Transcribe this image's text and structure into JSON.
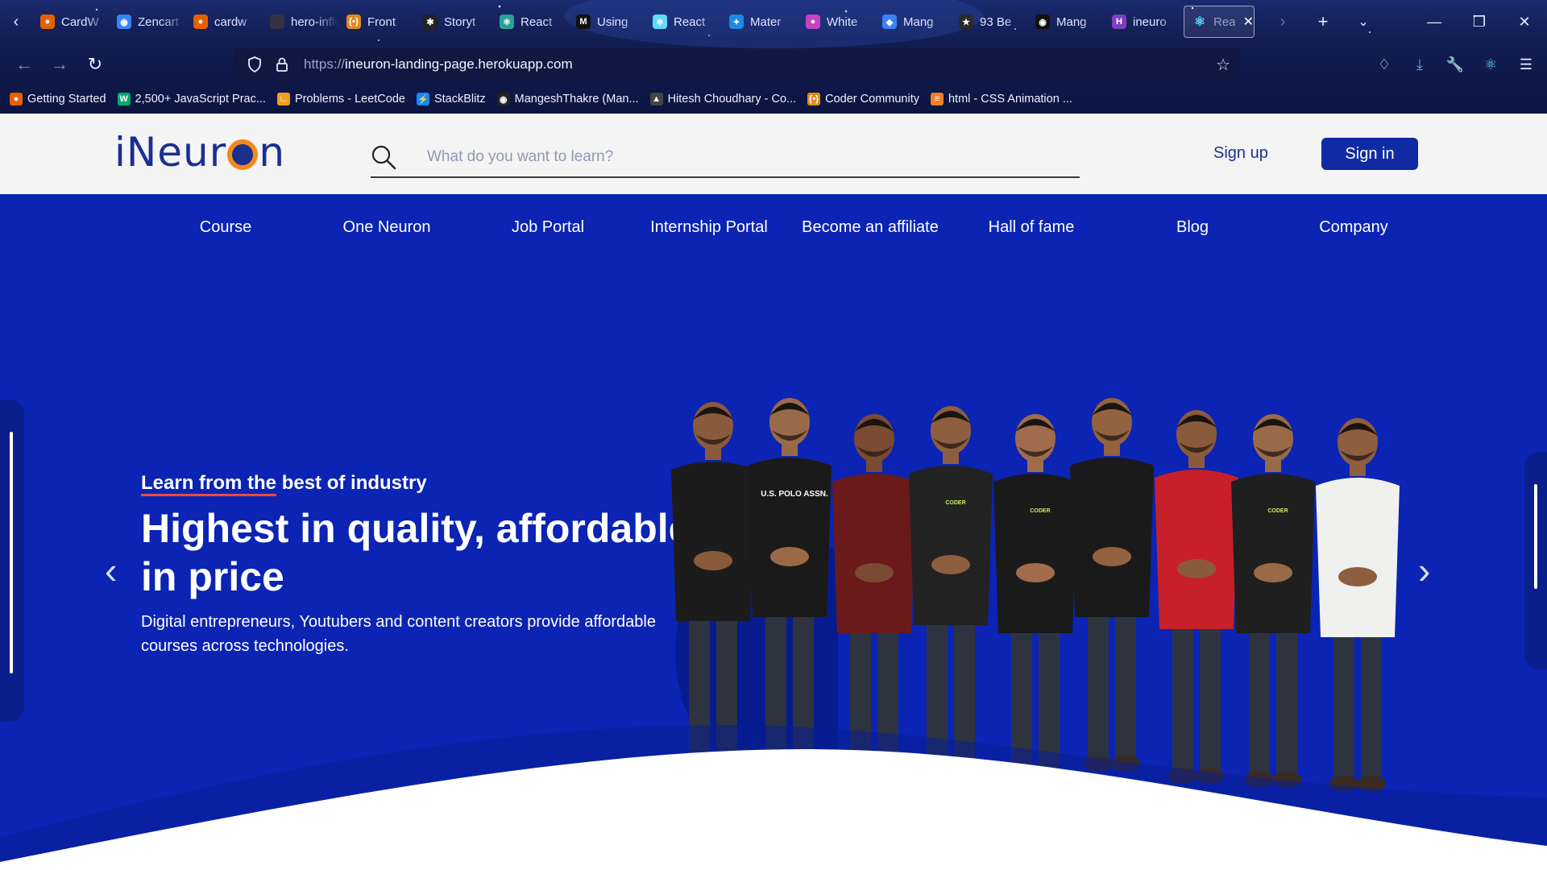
{
  "browser": {
    "tabs": [
      {
        "label": "CardW",
        "icon": "firefox-icon",
        "color": "#e66000"
      },
      {
        "label": "Zencart",
        "icon": "globe-icon",
        "color": "#3b82f6"
      },
      {
        "label": "cardw",
        "icon": "firefox-icon",
        "color": "#e66000"
      },
      {
        "label": "hero-influ",
        "icon": "blank-icon",
        "color": "#334"
      },
      {
        "label": "Front",
        "icon": "code-icon",
        "color": "#e08a1a"
      },
      {
        "label": "Storyt",
        "icon": "sparkle-icon",
        "color": "#222"
      },
      {
        "label": "React",
        "icon": "react-icon",
        "color": "#2aa198"
      },
      {
        "label": "Using",
        "icon": "medium-icon",
        "color": "#111"
      },
      {
        "label": "React",
        "icon": "react-icon",
        "color": "#61dafb"
      },
      {
        "label": "Mater",
        "icon": "material-icon",
        "color": "#1e88e5"
      },
      {
        "label": "White",
        "icon": "drop-icon",
        "color": "#c542c5"
      },
      {
        "label": "Mang",
        "icon": "diamond-icon",
        "color": "#3b82f6"
      },
      {
        "label": "93 Be",
        "icon": "badge-icon",
        "color": "#2a2a2a"
      },
      {
        "label": "Mang",
        "icon": "github-icon",
        "color": "#111"
      },
      {
        "label": "ineuro",
        "icon": "h-icon",
        "color": "#7b3fbf"
      }
    ],
    "active_tab": {
      "label": "Rea",
      "icon": "react-icon"
    },
    "url_proto": "https://",
    "url_host": "ineuron-landing-page.herokuapp.com",
    "bookmarks": [
      {
        "label": "Getting Started",
        "icon": "firefox-icon",
        "color": "#e66000"
      },
      {
        "label": "2,500+ JavaScript Prac...",
        "icon": "w3-icon",
        "color": "#04aa6d"
      },
      {
        "label": "Problems - LeetCode",
        "icon": "leetcode-icon",
        "color": "#f0a020"
      },
      {
        "label": "StackBlitz",
        "icon": "bolt-icon",
        "color": "#1389fd"
      },
      {
        "label": "MangeshThakre (Man...",
        "icon": "github-icon",
        "color": "#222"
      },
      {
        "label": "Hitesh Choudhary - Co...",
        "icon": "cube-icon",
        "color": "#444"
      },
      {
        "label": "Coder Community",
        "icon": "code-icon",
        "color": "#e08a1a"
      },
      {
        "label": "html - CSS Animation ...",
        "icon": "stack-icon",
        "color": "#f48024"
      }
    ]
  },
  "header": {
    "logo_left": "iNeur",
    "logo_right": "n",
    "search_placeholder": "What do you want to learn?",
    "signup_label": "Sign up",
    "signin_label": "Sign in"
  },
  "menu": [
    {
      "label": "Course"
    },
    {
      "label": "One Neuron"
    },
    {
      "label": "Job Portal"
    },
    {
      "label": "Internship Portal"
    },
    {
      "label": "Become an affiliate"
    },
    {
      "label": "Hall of fame"
    },
    {
      "label": "Blog"
    },
    {
      "label": "Company"
    }
  ],
  "hero": {
    "eyebrow_underlined": "Learn from the",
    "eyebrow_rest": " best of industry",
    "headline": "Highest in quality, affordable in price",
    "subtext": "Digital entrepreneurs, Youtubers and content creators provide affordable courses across technologies.",
    "prev_icon": "chevron-left-icon",
    "next_icon": "chevron-right-icon",
    "people": [
      {
        "shirt": "#1c1c1c",
        "logo": ""
      },
      {
        "shirt": "#1a1a1a",
        "logo": "U.S. POLO ASSN."
      },
      {
        "shirt": "#6a1a1a",
        "logo": ""
      },
      {
        "shirt": "#222222",
        "logo": "CODER"
      },
      {
        "shirt": "#1a1a1a",
        "logo": "CODER"
      },
      {
        "shirt": "#1a1a1a",
        "logo": ""
      },
      {
        "shirt": "#c8202a",
        "logo": ""
      },
      {
        "shirt": "#1f1f1f",
        "logo": "CODER"
      },
      {
        "shirt": "#f0f0ee",
        "logo": ""
      }
    ]
  },
  "colors": {
    "brand_blue": "#0b24b4",
    "logo_blue": "#1b2f8f",
    "logo_orange": "#f08a1a",
    "signin_bg": "#0f2aa3",
    "underline_red": "#f0493a"
  }
}
